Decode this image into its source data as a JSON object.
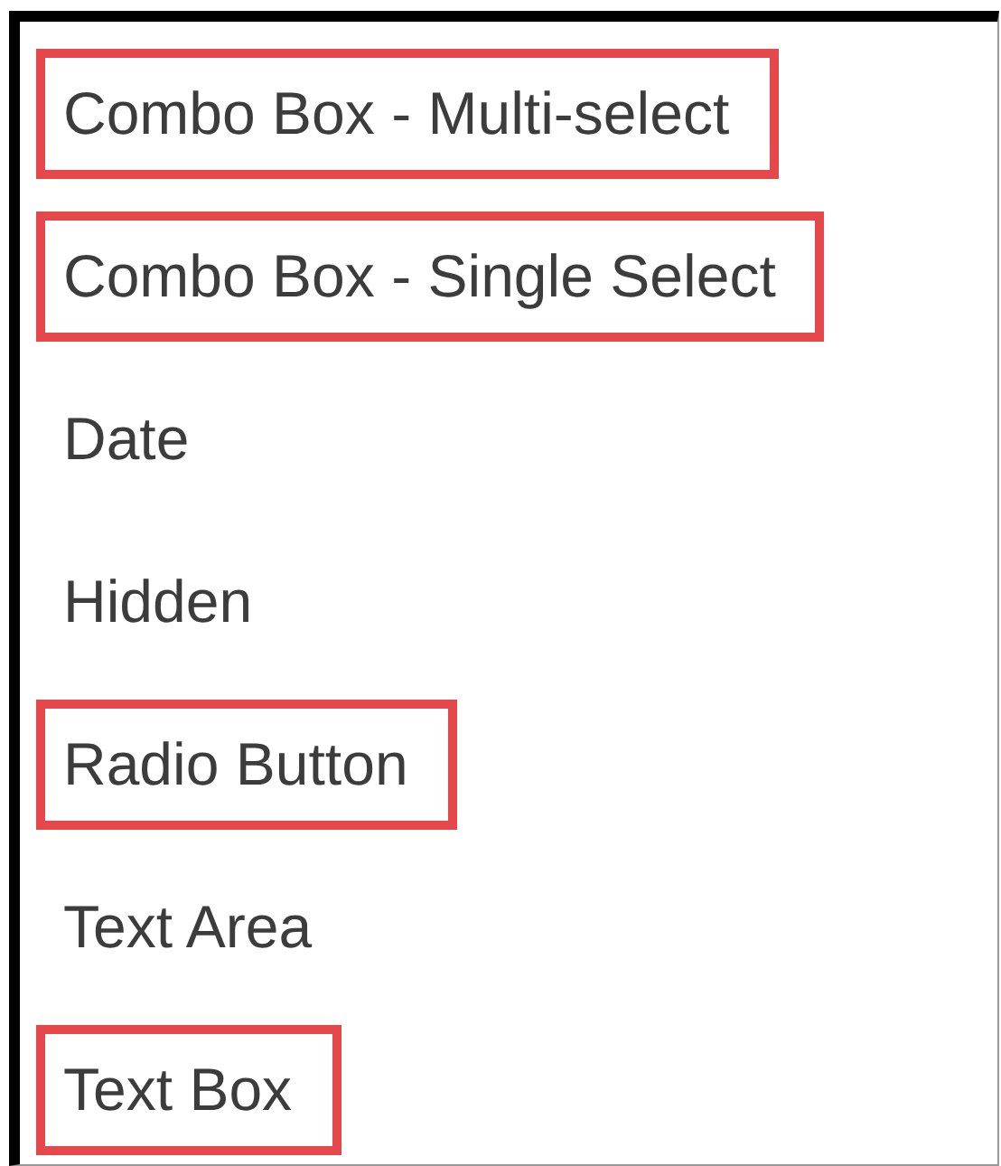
{
  "items": [
    {
      "label": "Combo Box - Multi-select",
      "highlighted": true
    },
    {
      "label": "Combo Box - Single Select",
      "highlighted": true
    },
    {
      "label": "Date",
      "highlighted": false
    },
    {
      "label": "Hidden",
      "highlighted": false
    },
    {
      "label": "Radio Button",
      "highlighted": true
    },
    {
      "label": "Text Area",
      "highlighted": false
    },
    {
      "label": "Text Box",
      "highlighted": true
    }
  ]
}
